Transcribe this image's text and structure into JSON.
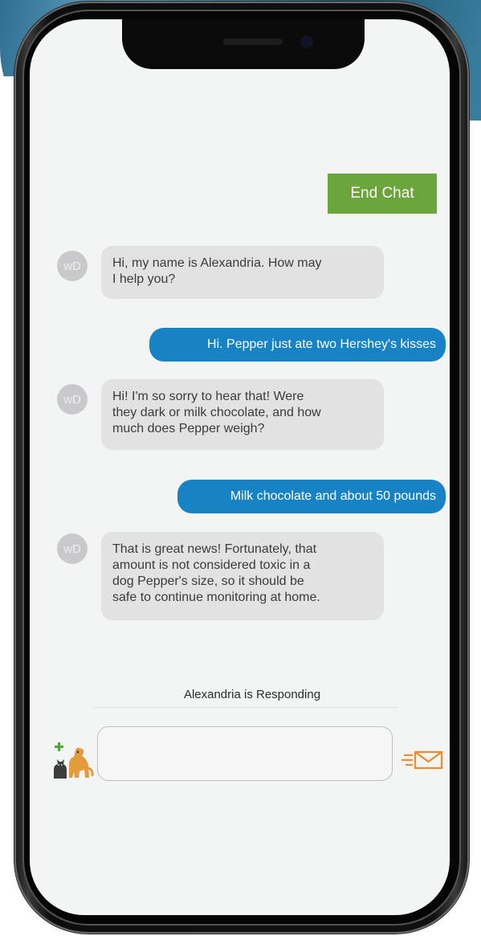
{
  "header": {
    "end_chat_label": "End Chat"
  },
  "messages": [
    {
      "sender": "agent",
      "avatar": "wD",
      "text_lines": [
        "Hi, my name is Alexandria. How may",
        "I help you?"
      ]
    },
    {
      "sender": "user",
      "text": "Hi. Pepper just ate two Hershey's kisses"
    },
    {
      "sender": "agent",
      "avatar": "wD",
      "text_lines": [
        "Hi! I'm so sorry to hear that! Were",
        "they dark or milk chocolate, and how",
        "much does Pepper weigh?"
      ]
    },
    {
      "sender": "user",
      "text": "Milk chocolate and about 50 pounds"
    },
    {
      "sender": "agent",
      "avatar": "wD",
      "text_lines": [
        "That is great news! Fortunately, that",
        "amount is not considered toxic in a",
        "dog Pepper's size, so it should be",
        "safe to continue monitoring at home."
      ]
    }
  ],
  "status_text": "Alexandria is Responding",
  "composer": {
    "value": "",
    "placeholder": "",
    "attach_icon": "pet-add-icon",
    "send_icon": "envelope-send-icon"
  },
  "colors": {
    "end_chat": "#6aa43a",
    "user_bubble": "#1782c4",
    "agent_bubble": "#e3e2e3",
    "avatar": "#c9c9cb",
    "send_icon": "#f08a2a"
  }
}
